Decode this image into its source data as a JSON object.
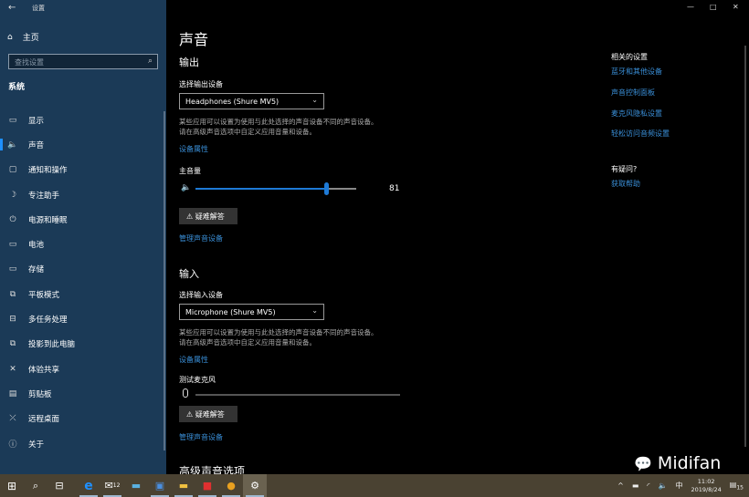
{
  "window": {
    "title": "设置",
    "back_icon": "arrow-left-icon",
    "minimize": "—",
    "maximize": "□",
    "close": "✕"
  },
  "sidebar": {
    "home": "主页",
    "search_placeholder": "查找设置",
    "section": "系统",
    "items": [
      {
        "label": "显示",
        "icon": "monitor-icon",
        "glyph": "▭"
      },
      {
        "label": "声音",
        "icon": "speaker-icon",
        "glyph": "🔈"
      },
      {
        "label": "通知和操作",
        "icon": "notification-icon",
        "glyph": "▢"
      },
      {
        "label": "专注助手",
        "icon": "moon-icon",
        "glyph": "☽"
      },
      {
        "label": "电源和睡眠",
        "icon": "power-icon",
        "glyph": "⏻"
      },
      {
        "label": "电池",
        "icon": "battery-icon",
        "glyph": "▭"
      },
      {
        "label": "存储",
        "icon": "storage-icon",
        "glyph": "▭"
      },
      {
        "label": "平板模式",
        "icon": "tablet-icon",
        "glyph": "⧉"
      },
      {
        "label": "多任务处理",
        "icon": "multitask-icon",
        "glyph": "⊟"
      },
      {
        "label": "投影到此电脑",
        "icon": "project-icon",
        "glyph": "⧉"
      },
      {
        "label": "体验共享",
        "icon": "share-icon",
        "glyph": "✕"
      },
      {
        "label": "剪贴板",
        "icon": "clipboard-icon",
        "glyph": "▤"
      },
      {
        "label": "远程桌面",
        "icon": "remote-icon",
        "glyph": "⤫"
      },
      {
        "label": "关于",
        "icon": "info-icon",
        "glyph": "ⓘ"
      }
    ],
    "active": "声音"
  },
  "main": {
    "title": "声音",
    "output": {
      "heading": "输出",
      "select_label": "选择输出设备",
      "device": "Headphones (Shure MV5)",
      "desc1": "某些应用可以设置为使用与此处选择的声音设备不同的声音设备。",
      "desc2": "请在高级声音选项中自定义应用音量和设备。",
      "properties": "设备属性",
      "volume_label": "主音量",
      "volume": 81,
      "volume_text": "81",
      "troubleshoot": "疑难解答",
      "manage": "管理声音设备"
    },
    "input": {
      "heading": "输入",
      "select_label": "选择输入设备",
      "device": "Microphone (Shure MV5)",
      "desc1": "某些应用可以设置为使用与此处选择的声音设备不同的声音设备。",
      "desc2": "请在高级声音选项中自定义应用音量和设备。",
      "properties": "设备属性",
      "test_label": "测试麦克风",
      "level": 0,
      "troubleshoot": "疑难解答",
      "manage": "管理声音设备"
    },
    "advanced": "高级声音选项"
  },
  "related": {
    "heading": "相关的设置",
    "links": [
      "蓝牙和其他设备",
      "声音控制面板",
      "麦克风隐私设置",
      "轻松访问音频设置"
    ],
    "question": "有疑问?",
    "help": "获取帮助"
  },
  "watermark": "Midifan",
  "taskbar": {
    "mail_badge": "12",
    "ime": "中",
    "time": "11:02",
    "date": "2019/8/24",
    "notifications": "15"
  },
  "colors": {
    "sidebar": "#1b3a57",
    "accent": "#1e7ad6",
    "link": "#3a8fd8",
    "taskbar": "#4a4232"
  }
}
